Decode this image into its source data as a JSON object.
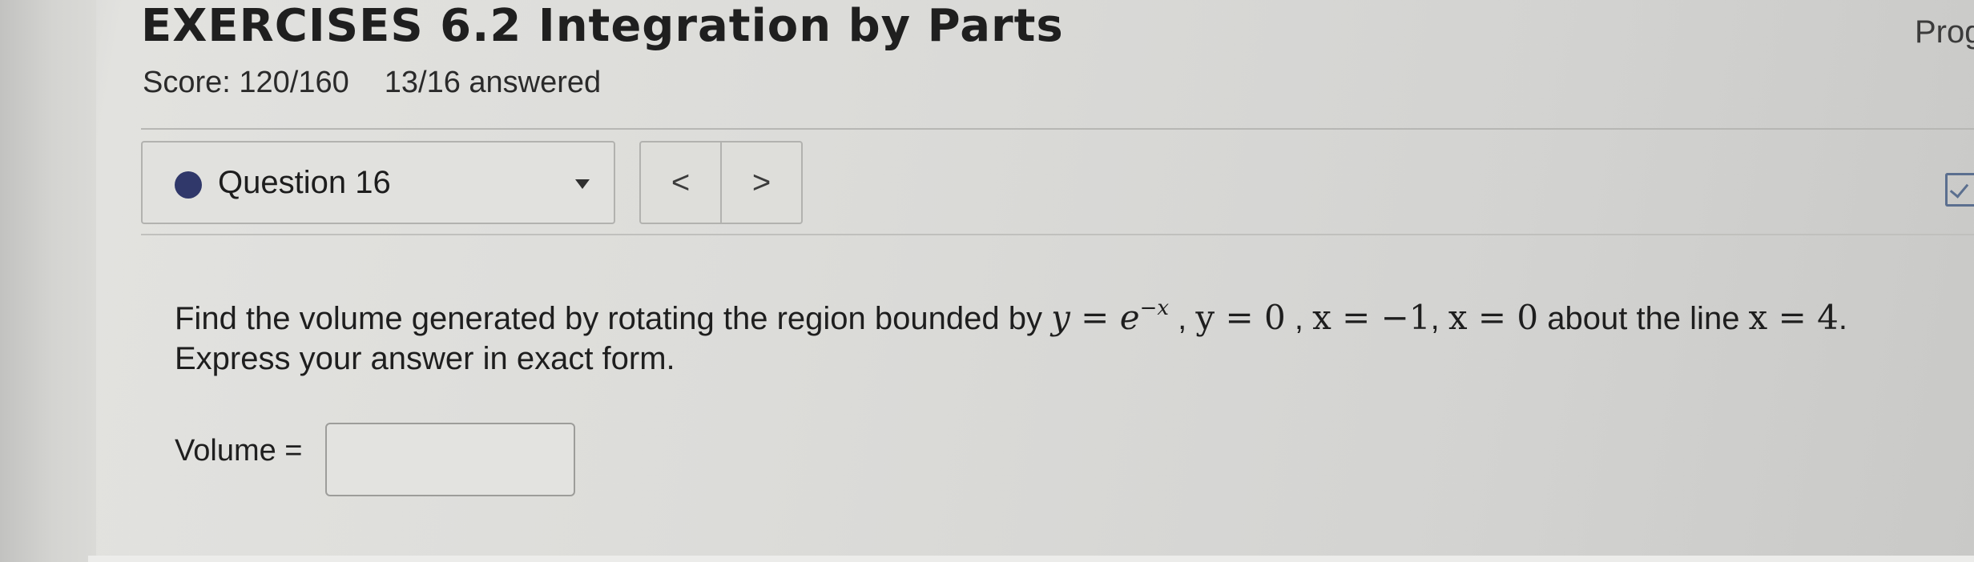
{
  "header": {
    "title": "EXERCISES 6.2 Integration by Parts",
    "score": "Score: 120/160",
    "answered": "13/16 answered",
    "progress_label": "Prog"
  },
  "question_nav": {
    "selected_question": "Question 16",
    "prev_symbol": "<",
    "next_symbol": ">",
    "status_color": "#30386a"
  },
  "question": {
    "text_start": "Find the volume generated by rotating the region bounded by ",
    "eq1_lhs": "y",
    "eq1_rhs_base": "e",
    "eq1_exponent": "−x",
    "eq2": "y = 0",
    "eq3": "x = −1",
    "eq4": "x = 0",
    "text_mid": " about the line ",
    "axis_eq": "x = 4",
    "text_end": ". Express your answer in exact form."
  },
  "answer": {
    "label": "Volume =",
    "value": ""
  },
  "icons": {
    "status": "status-dot-icon",
    "dropdown": "chevron-down-icon",
    "report": "report-check-icon"
  }
}
